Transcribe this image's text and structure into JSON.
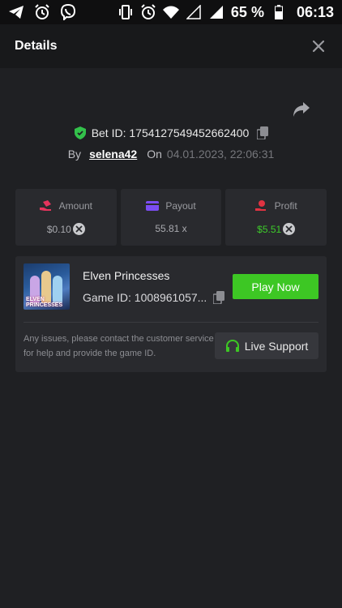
{
  "status_bar": {
    "left_icons": [
      "telegram-icon",
      "alarm-icon",
      "viber-icon"
    ],
    "right_icons": [
      "vibrate-icon",
      "alarm-icon",
      "wifi-icon",
      "signal-empty-icon",
      "signal-icon",
      "battery-icon"
    ],
    "battery": "65 %",
    "time": "06:13"
  },
  "header": {
    "title": "Details"
  },
  "bet": {
    "id_label": "Bet ID: 1754127549452662400",
    "by_label": "By",
    "username": "selena42",
    "on_label": "On",
    "date": "04.01.2023, 22:06:31"
  },
  "stats": [
    {
      "label": "Amount",
      "value": "$0.10",
      "icon": "amount-icon",
      "color": "#e5345d",
      "currency_icon": true
    },
    {
      "label": "Payout",
      "value": "55.81 x",
      "icon": "card-icon",
      "color": "#7b4df2",
      "currency_icon": false
    },
    {
      "label": "Profit",
      "value": "$5.51",
      "icon": "profit-icon",
      "color": "#e03342",
      "currency_icon": true
    }
  ],
  "game": {
    "name": "Elven Princesses",
    "game_id": "Game ID: 1008961057...",
    "thumbnail_text": "ELVEN PRINCESSES",
    "play_label": "Play Now",
    "help_text": "Any issues, please contact the customer service for help and provide the game ID.",
    "support_label": "Live Support"
  },
  "colors": {
    "accent_green": "#3dc724",
    "background": "#1f2023",
    "panel": "#292a2e"
  }
}
